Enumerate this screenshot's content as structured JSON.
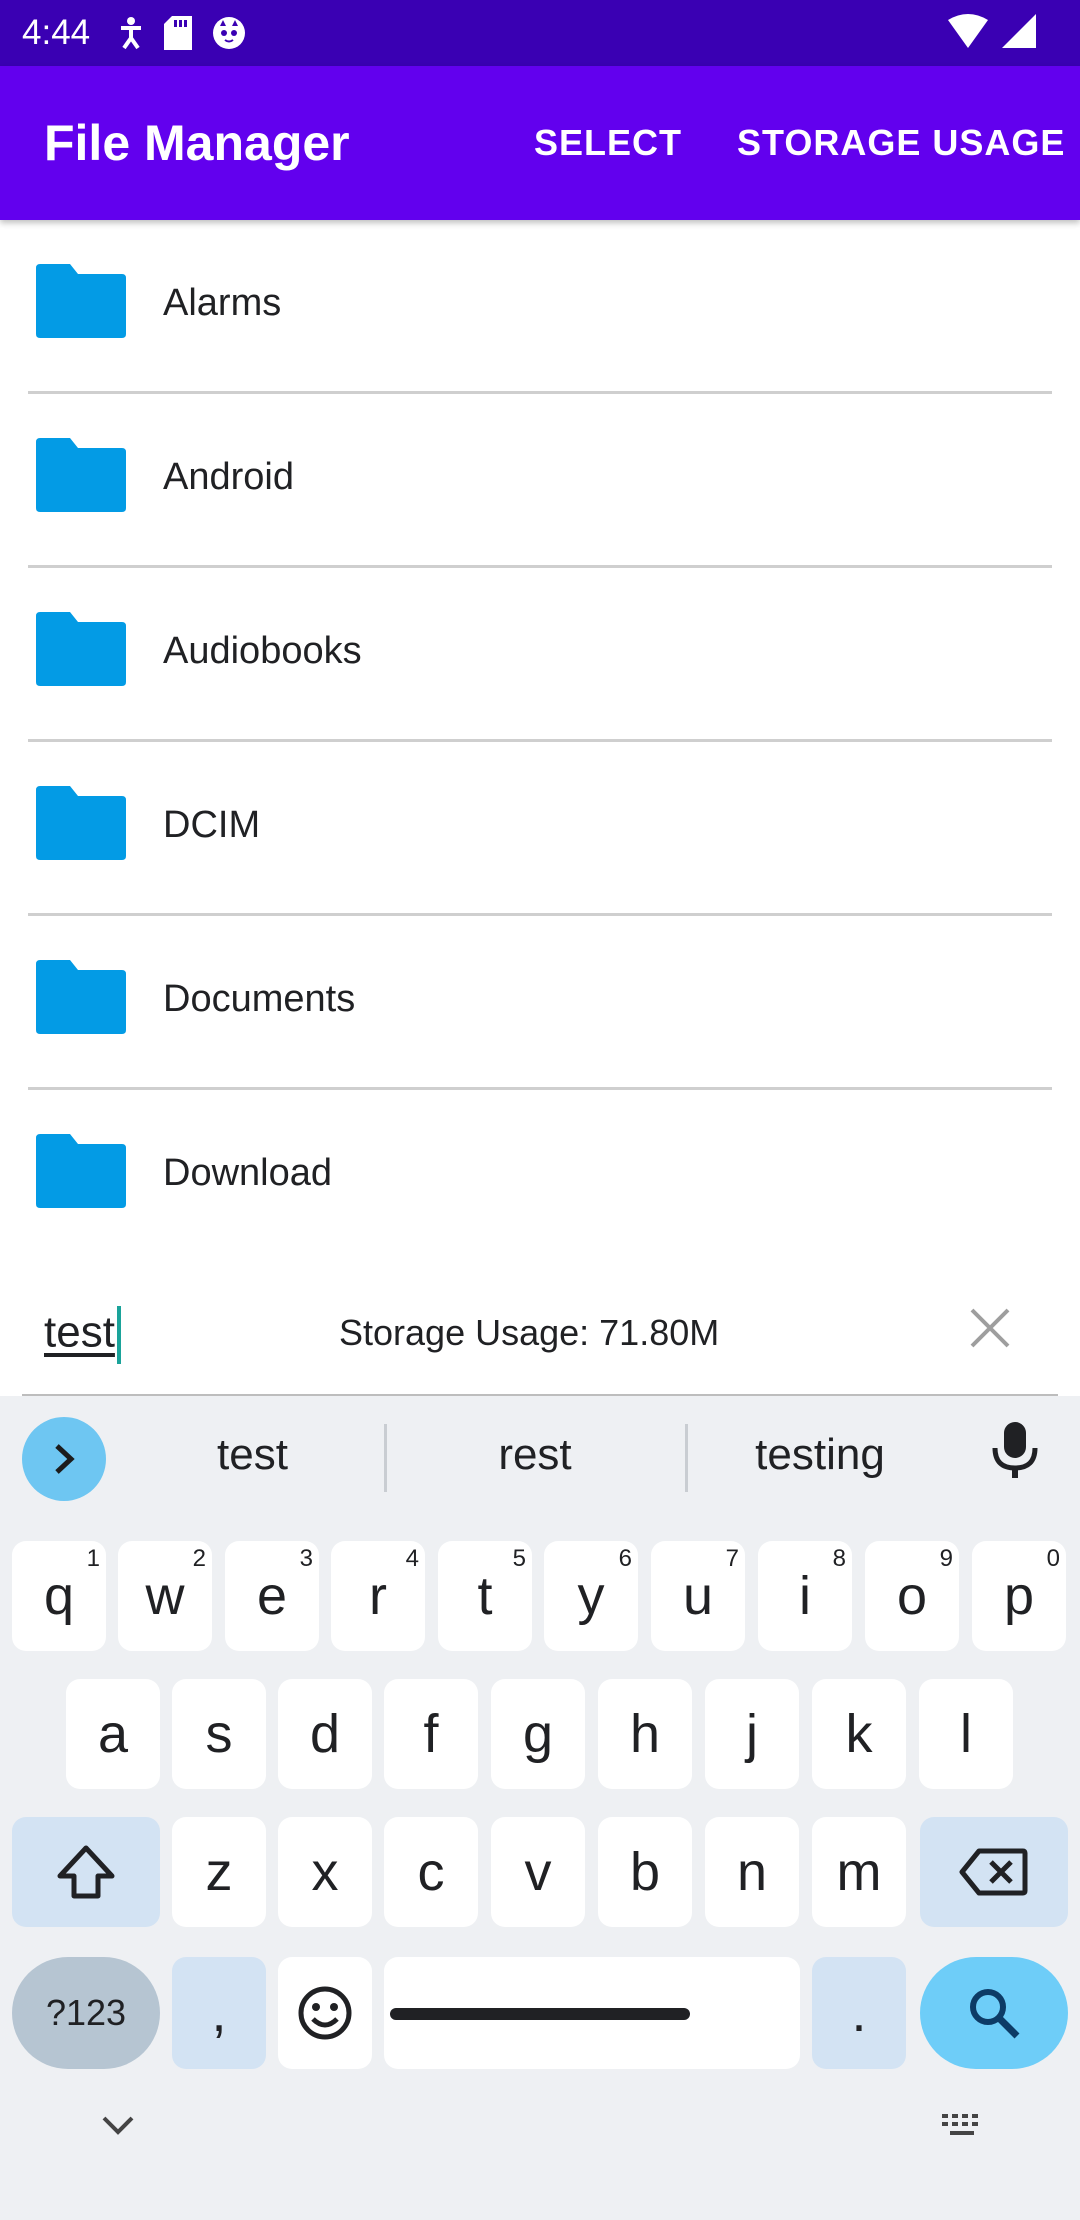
{
  "status_bar": {
    "time": "4:44"
  },
  "app_bar": {
    "title": "File Manager",
    "select_label": "SELECT",
    "storage_usage_label": "STORAGE USAGE"
  },
  "files": [
    {
      "name": "Alarms"
    },
    {
      "name": "Android"
    },
    {
      "name": "Audiobooks"
    },
    {
      "name": "DCIM"
    },
    {
      "name": "Documents"
    },
    {
      "name": "Download"
    }
  ],
  "search": {
    "value": "test",
    "storage_text": "Storage Usage: 71.80M"
  },
  "keyboard": {
    "suggestions": [
      "test",
      "rest",
      "testing"
    ],
    "row1": [
      {
        "key": "q",
        "hint": "1"
      },
      {
        "key": "w",
        "hint": "2"
      },
      {
        "key": "e",
        "hint": "3"
      },
      {
        "key": "r",
        "hint": "4"
      },
      {
        "key": "t",
        "hint": "5"
      },
      {
        "key": "y",
        "hint": "6"
      },
      {
        "key": "u",
        "hint": "7"
      },
      {
        "key": "i",
        "hint": "8"
      },
      {
        "key": "o",
        "hint": "9"
      },
      {
        "key": "p",
        "hint": "0"
      }
    ],
    "row2": [
      "a",
      "s",
      "d",
      "f",
      "g",
      "h",
      "j",
      "k",
      "l"
    ],
    "row3": [
      "z",
      "x",
      "c",
      "v",
      "b",
      "n",
      "m"
    ],
    "symbols_label": "?123",
    "comma_label": ",",
    "period_label": "."
  },
  "colors": {
    "status_bar": "#3a00b3",
    "app_bar": "#6200ee",
    "folder": "#039be5",
    "keyboard_bg": "#eef0f3"
  }
}
